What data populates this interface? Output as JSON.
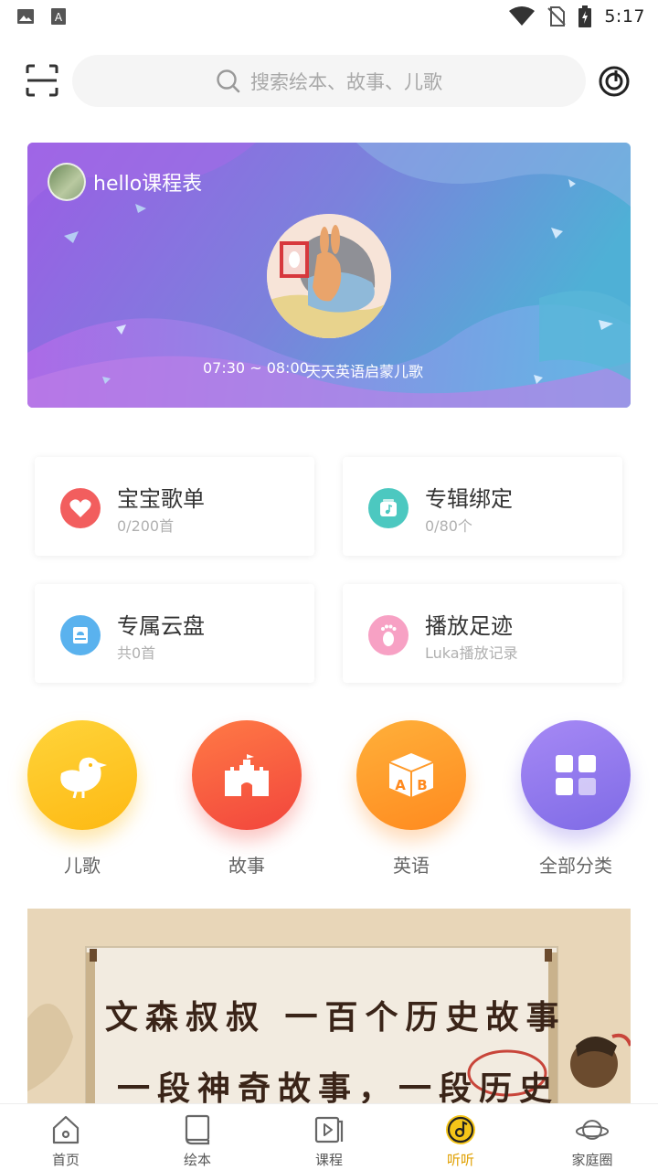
{
  "status_bar": {
    "time": "5:17"
  },
  "header": {
    "search_placeholder": "搜索绘本、故事、儿歌"
  },
  "banner": {
    "title": "hello课程表",
    "time_range": "07:30 ~ 08:00",
    "program": "天天英语启蒙儿歌"
  },
  "cards": [
    {
      "title": "宝宝歌单",
      "subtitle": "0/200首",
      "icon": "heart-icon",
      "color": "#f25e5e"
    },
    {
      "title": "专辑绑定",
      "subtitle": "0/80个",
      "icon": "music-note-icon",
      "color": "#4cc8c0"
    },
    {
      "title": "专属云盘",
      "subtitle": "共0首",
      "icon": "cloud-drive-icon",
      "color": "#5ab2ee"
    },
    {
      "title": "播放足迹",
      "subtitle": "Luka播放记录",
      "icon": "footprint-icon",
      "color": "#f7a1c4"
    }
  ],
  "categories": [
    {
      "label": "儿歌",
      "icon": "bird-icon"
    },
    {
      "label": "故事",
      "icon": "castle-icon"
    },
    {
      "label": "英语",
      "icon": "ab-block-icon"
    },
    {
      "label": "全部分类",
      "icon": "grid-icon"
    }
  ],
  "promo": {
    "line1": "文森叔叔 一百个历史故事",
    "line2": "一段神奇故事，一段历史"
  },
  "nav": [
    {
      "label": "首页",
      "icon": "home-icon"
    },
    {
      "label": "绘本",
      "icon": "book-icon"
    },
    {
      "label": "课程",
      "icon": "play-course-icon"
    },
    {
      "label": "听听",
      "icon": "listen-icon",
      "active": true
    },
    {
      "label": "家庭圈",
      "icon": "planet-icon"
    }
  ],
  "colors": {
    "accent": "#f5c518",
    "banner_start": "#9b5de5",
    "banner_end": "#4fb0d6"
  }
}
